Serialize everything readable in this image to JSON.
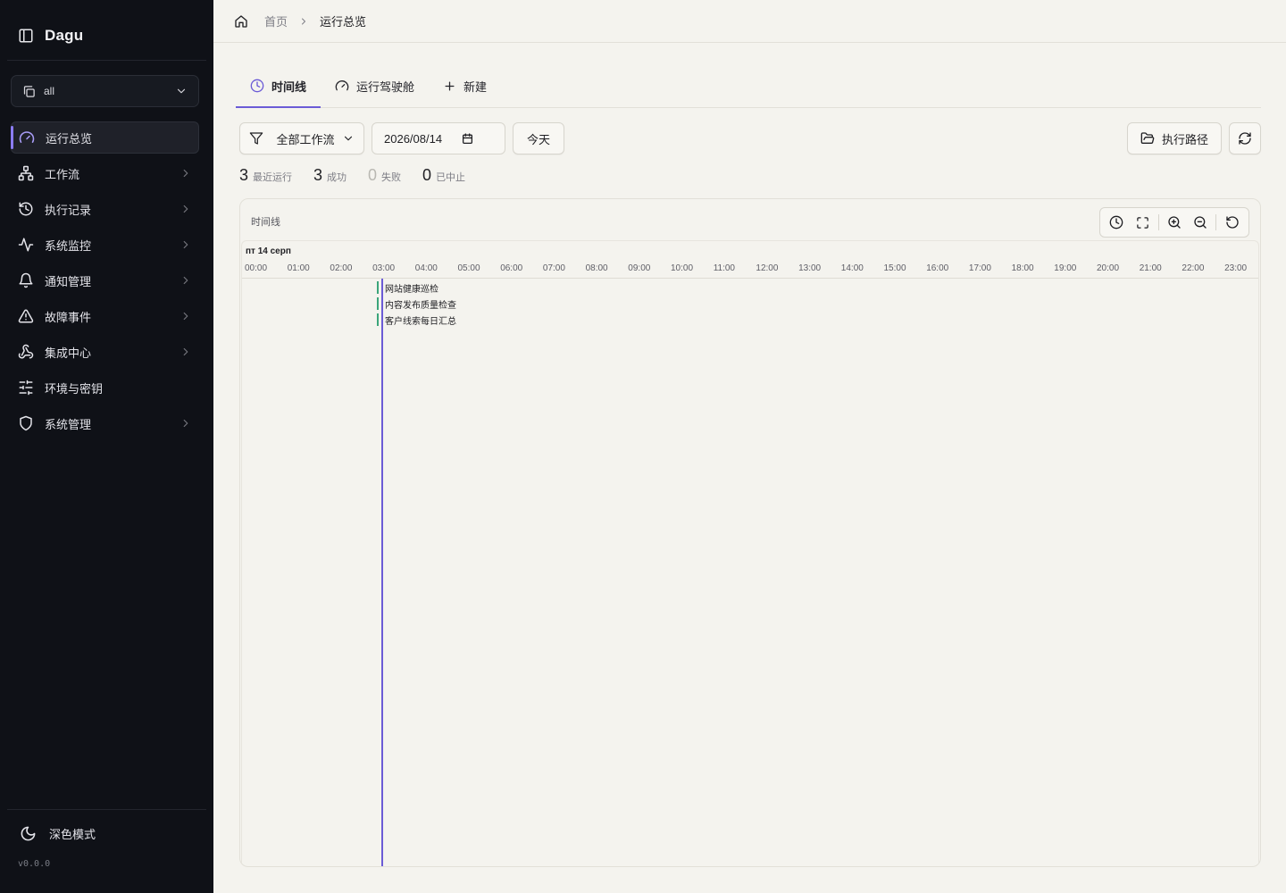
{
  "sidebar": {
    "brand": "Dagu",
    "namespace": "all",
    "items": [
      {
        "label": "运行总览",
        "icon": "gauge-icon"
      },
      {
        "label": "工作流",
        "icon": "workflow-icon"
      },
      {
        "label": "执行记录",
        "icon": "history-icon"
      },
      {
        "label": "系统监控",
        "icon": "activity-icon"
      },
      {
        "label": "通知管理",
        "icon": "bell-icon"
      },
      {
        "label": "故障事件",
        "icon": "alert-triangle-icon"
      },
      {
        "label": "集成中心",
        "icon": "webhook-icon"
      },
      {
        "label": "环境与密钥",
        "icon": "sliders-icon"
      },
      {
        "label": "系统管理",
        "icon": "shield-icon"
      }
    ],
    "dark_mode_label": "深色模式",
    "version": "v0.0.0"
  },
  "header": {
    "breadcrumb_home": "首页",
    "breadcrumb_current": "运行总览"
  },
  "tabs": [
    {
      "label": "时间线"
    },
    {
      "label": "运行驾驶舱"
    },
    {
      "label": "新建"
    }
  ],
  "toolbar": {
    "filter_label": "全部工作流",
    "date_value": "2026/08/14",
    "today_label": "今天",
    "exec_path_label": "执行路径"
  },
  "stats": [
    {
      "value": "3",
      "label": "最近运行"
    },
    {
      "value": "3",
      "label": "成功"
    },
    {
      "value": "0",
      "label": "失败"
    },
    {
      "value": "0",
      "label": "已中止"
    }
  ],
  "timeline": {
    "title": "时间线",
    "date_label": "пт 14 серп",
    "ticks": [
      "00:00",
      "01:00",
      "02:00",
      "03:00",
      "04:00",
      "05:00",
      "06:00",
      "07:00",
      "08:00",
      "09:00",
      "10:00",
      "11:00",
      "12:00",
      "13:00",
      "14:00",
      "15:00",
      "16:00",
      "17:00",
      "18:00",
      "19:00",
      "20:00",
      "21:00",
      "22:00",
      "23:00"
    ],
    "now_hour": 2.9,
    "runs": [
      {
        "name": "网站健康巡检",
        "start_hour": 2.83
      },
      {
        "name": "内容发布质量检查",
        "start_hour": 2.83
      },
      {
        "name": "客户线索每日汇总",
        "start_hour": 2.83
      }
    ],
    "accent_color": "#6b5bd6",
    "success_color": "#3aa57a"
  }
}
